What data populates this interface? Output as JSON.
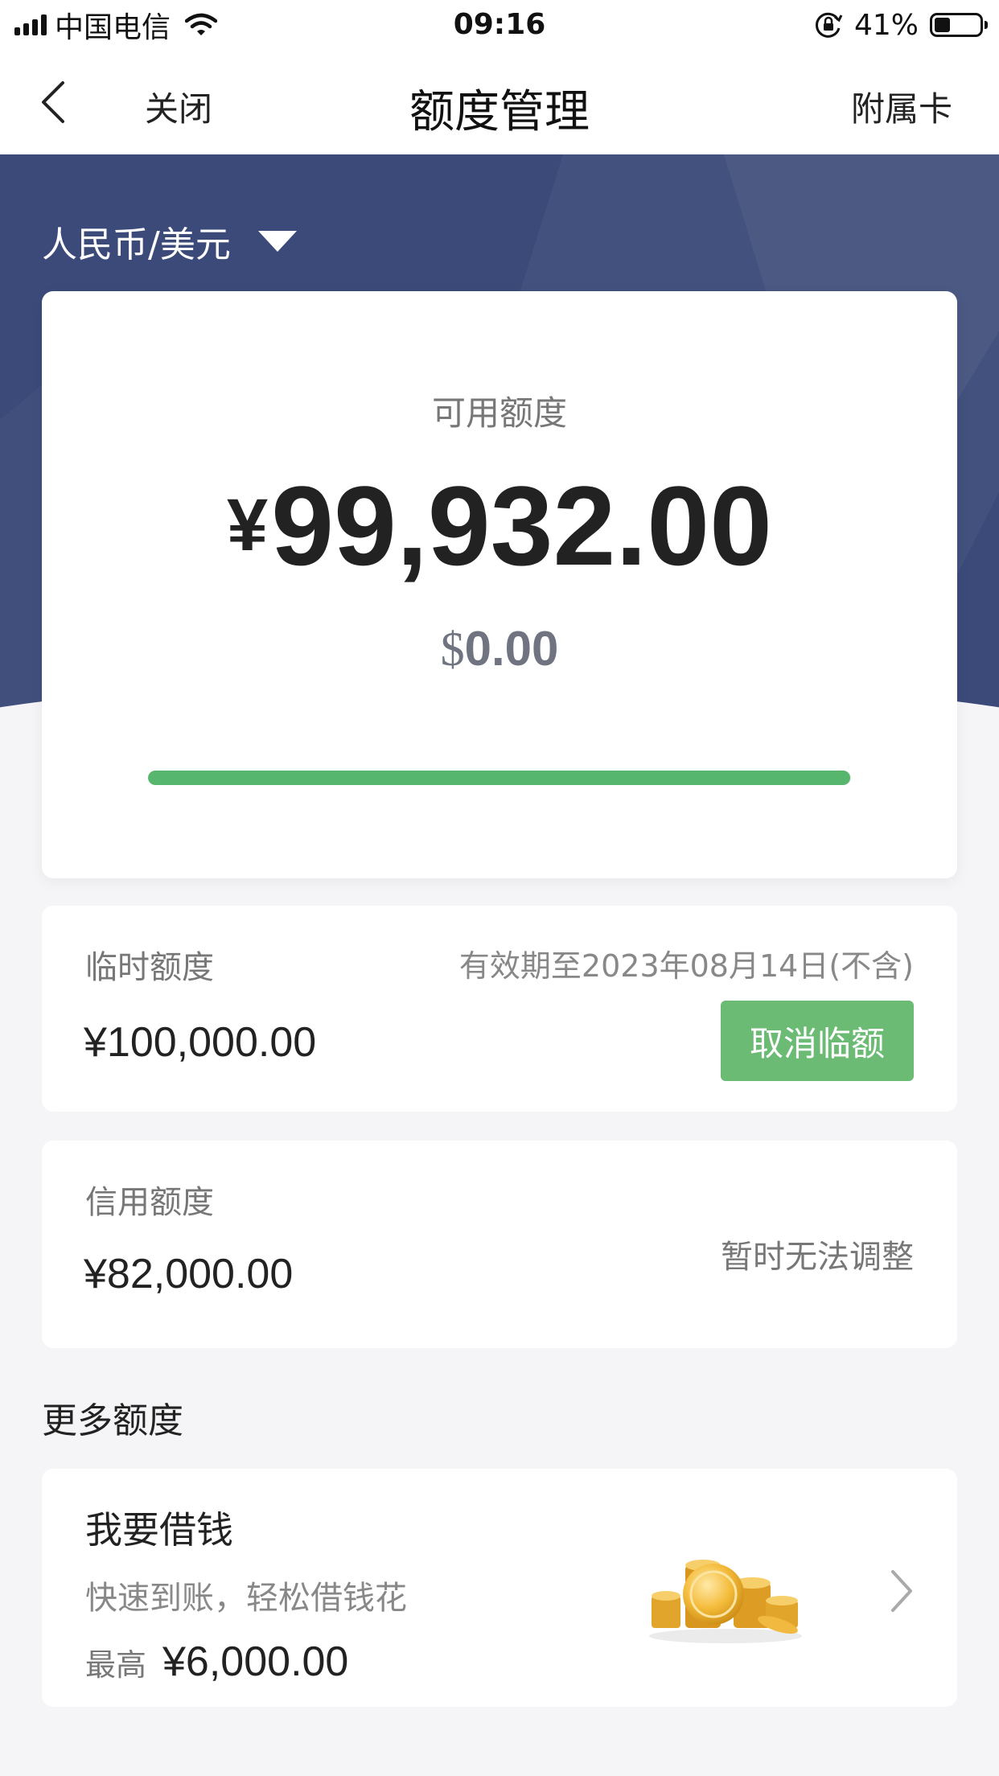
{
  "status_bar": {
    "carrier": "中国电信",
    "time": "09:16",
    "battery": "41%",
    "battery_level": 0.41
  },
  "nav": {
    "close": "关闭",
    "title": "额度管理",
    "right": "附属卡"
  },
  "currency_selector": "人民币/美元",
  "available": {
    "label": "可用额度",
    "cny_symbol": "¥",
    "cny_value": "99,932.00",
    "usd_symbol": "$",
    "usd_value": "0.00",
    "usage_fraction": 0.9993
  },
  "temp_limit": {
    "label": "临时额度",
    "amount": "¥100,000.00",
    "validity": "有效期至2023年08月14日(不含)",
    "cancel_button": "取消临额"
  },
  "credit_limit": {
    "label": "信用额度",
    "amount": "¥82,000.00",
    "status": "暂时无法调整"
  },
  "more": {
    "title": "更多额度",
    "loan": {
      "title": "我要借钱",
      "subtitle": "快速到账，轻松借钱花",
      "max_label": "最高",
      "max_amount": "¥6,000.00"
    }
  },
  "colors": {
    "hero": "#3b4a78",
    "accent_green": "#56b66d",
    "button_green": "#6bbb75"
  }
}
